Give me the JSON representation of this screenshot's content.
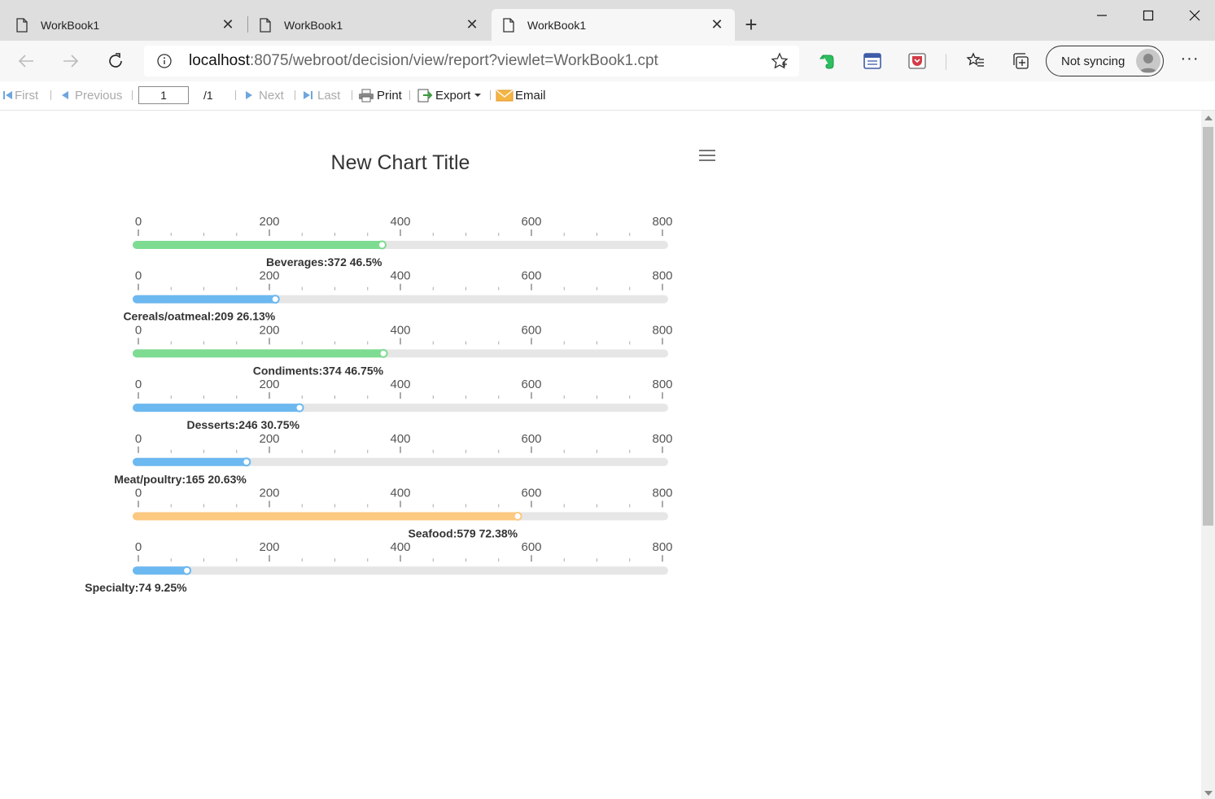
{
  "browser": {
    "tabs": [
      {
        "title": "WorkBook1",
        "active": false
      },
      {
        "title": "WorkBook1",
        "active": false
      },
      {
        "title": "WorkBook1",
        "active": true
      }
    ],
    "url_host": "localhost",
    "url_rest": ":8075/webroot/decision/view/report?viewlet=WorkBook1.cpt",
    "profile_label": "Not syncing",
    "icons": [
      "back-icon",
      "forward-icon",
      "refresh-icon",
      "info-icon",
      "favorite-star-icon",
      "evernote-icon",
      "reading-view-icon",
      "pocket-icon",
      "favorites-icon",
      "collections-icon",
      "more-icon"
    ]
  },
  "report_toolbar": {
    "first": "First",
    "previous": "Previous",
    "page_value": "1",
    "page_total": "/1",
    "next": "Next",
    "last": "Last",
    "print": "Print",
    "export": "Export",
    "email": "Email"
  },
  "chart_data": {
    "type": "bar",
    "title": "New Chart Title",
    "ticks": [
      0,
      200,
      400,
      600,
      800
    ],
    "xlim": [
      0,
      800
    ],
    "categories": [
      "Beverages",
      "Cereals/oatmeal",
      "Condiments",
      "Desserts",
      "Meat/poultry",
      "Seafood",
      "Specialty"
    ],
    "values": [
      372,
      209,
      374,
      246,
      165,
      579,
      74
    ],
    "percents": [
      "46.5%",
      "26.13%",
      "46.75%",
      "30.75%",
      "20.63%",
      "72.38%",
      "9.25%"
    ],
    "colors": [
      "#7ddc92",
      "#6cb8f0",
      "#7ddc92",
      "#6cb8f0",
      "#6cb8f0",
      "#fcc980",
      "#6cb8f0"
    ],
    "track_color": "#e6e6e6"
  }
}
